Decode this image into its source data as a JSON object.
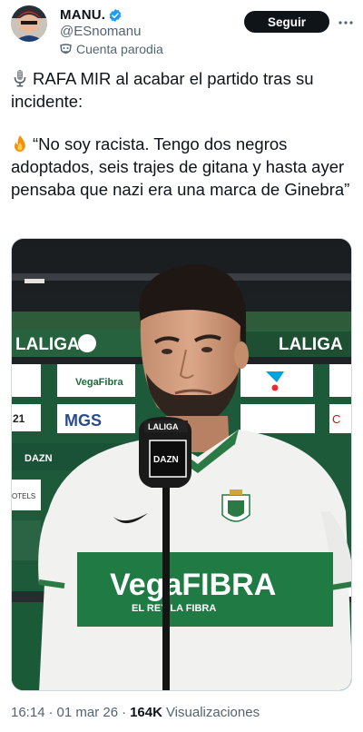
{
  "author": {
    "display_name": "MANU.",
    "handle": "@ESnomanu",
    "parody_label": "Cuenta parodia",
    "verified_color": "#1d9bf0"
  },
  "actions": {
    "follow_label": "Seguir",
    "more_icon": "more-horizontal-icon"
  },
  "tweet": {
    "line1": "RAFA MIR al acabar el partido tras su incidente:",
    "line1_emoji": "microphone-icon",
    "line2": "“No soy racista. Tengo dos negros adoptados, seis trajes de gitana y hasta ayer pensaba que nazi era una marca de Ginebra”",
    "line2_emoji": "fire-icon"
  },
  "media": {
    "banner_left": "LALIGA",
    "banner_right": "LALIGA",
    "sponsor_vega": "VegaFibra",
    "sponsor_mgs": "MGS",
    "board_21": "21",
    "board_dazn": "DAZN",
    "board_hotels": "OTELS",
    "mic_top": "LALIGA",
    "mic_brand": "DAZN",
    "shirt_sponsor": "VegaFIBRA",
    "shirt_tagline": "EL REY    LA FIBRA"
  },
  "footer": {
    "time": "16:14",
    "separator1": "·",
    "date": "01 mar 26",
    "separator2": "·",
    "views_count": "164K",
    "views_label": "Visualizaciones"
  }
}
